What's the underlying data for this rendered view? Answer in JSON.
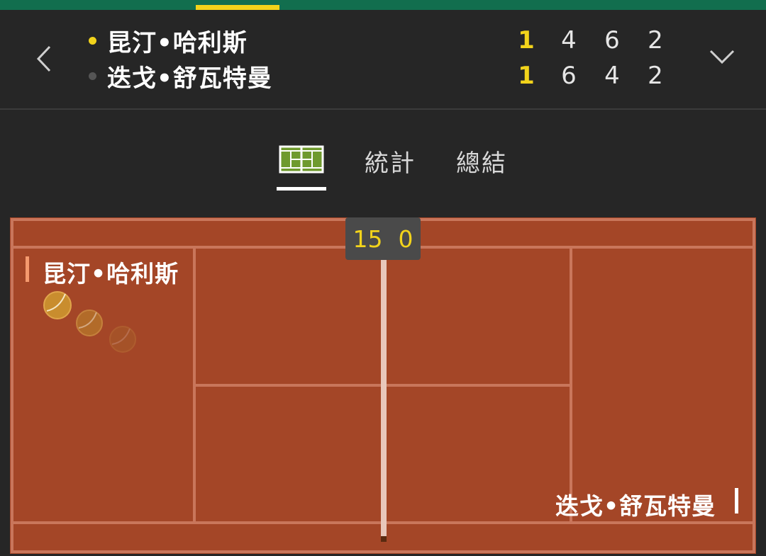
{
  "match": {
    "players": [
      {
        "name": "昆汀•哈利斯",
        "serving": true,
        "game": "1",
        "sets": [
          "4",
          "6",
          "2"
        ]
      },
      {
        "name": "迭戈•舒瓦特曼",
        "serving": false,
        "game": "1",
        "sets": [
          "6",
          "4",
          "2"
        ]
      }
    ]
  },
  "tabs": [
    {
      "label": "",
      "icon": "court-icon",
      "active": true
    },
    {
      "label": "統計",
      "active": false
    },
    {
      "label": "總結",
      "active": false
    }
  ],
  "court": {
    "top_player_label": "昆汀•哈利斯",
    "bottom_player_label": "迭戈•舒瓦特曼",
    "point_score": {
      "home": "15",
      "away": "0"
    }
  },
  "colors": {
    "accent_yellow": "#f2d31b",
    "brand_green": "#126e4e",
    "clay": "#a44627",
    "court_lines": "#c9765b",
    "background": "#262626"
  }
}
